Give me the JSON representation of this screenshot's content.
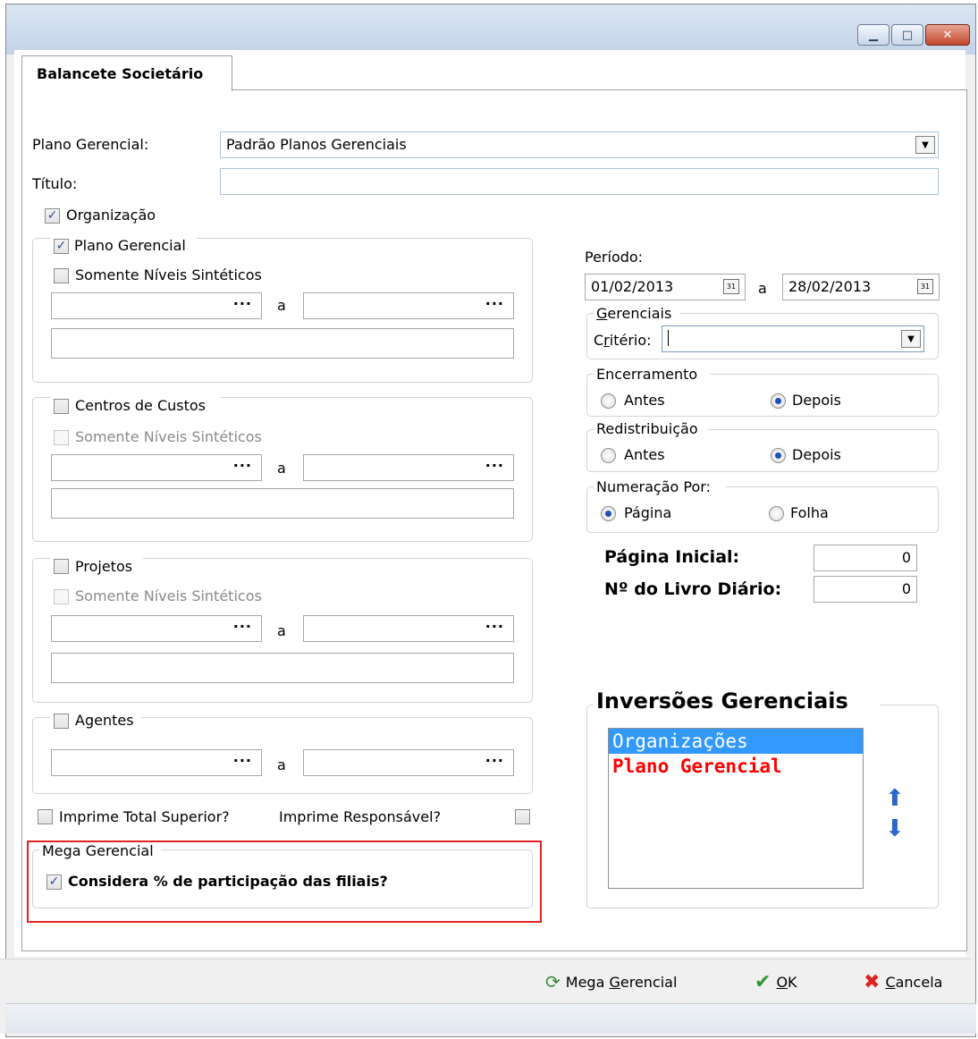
{
  "window": {
    "min_glyph": "▁",
    "max_glyph": "□",
    "close_glyph": "✕"
  },
  "tab": {
    "label": "Balancete Societário"
  },
  "plano_gerencial": {
    "label": "Plano Gerencial:",
    "value": "Padrão Planos Gerenciais"
  },
  "titulo": {
    "label": "Título:",
    "value": ""
  },
  "organizacao": {
    "label": "Organização",
    "checked": true
  },
  "grp_plano": {
    "label": "Plano Gerencial",
    "checked": true,
    "sintetico_label": "Somente Níveis Sintéticos",
    "dots": "···",
    "between": "a"
  },
  "grp_centros": {
    "label": "Centros de Custos",
    "sintetico_label": "Somente Níveis Sintéticos",
    "dots": "···",
    "between": "a"
  },
  "grp_projetos": {
    "label": "Projetos",
    "sintetico_label": "Somente Níveis Sintéticos",
    "dots": "···",
    "between": "a"
  },
  "grp_agentes": {
    "label": "Agentes",
    "dots": "···",
    "between": "a"
  },
  "imprime_total": {
    "label": "Imprime Total Superior?"
  },
  "imprime_resp": {
    "label": "Imprime Responsável?"
  },
  "mega_gerencial_group": {
    "label": "Mega Gerencial",
    "checkbox_label": "Considera % de participação das filiais?",
    "checked": true
  },
  "periodo": {
    "label": "Período:",
    "from": "01/02/2013",
    "between": "a",
    "to": "28/02/2013",
    "cal_glyph": "31"
  },
  "gerenciais": {
    "label_pre": "",
    "label_u": "G",
    "label_post": "erenciais",
    "criterio_u": "r",
    "criterio_pre": "C",
    "criterio_post": "itério:"
  },
  "encerramento": {
    "label": "Encerramento",
    "antes": "Antes",
    "depois": "Depois",
    "selected": "Depois"
  },
  "redistribuicao": {
    "label": "Redistribuição",
    "antes": "Antes",
    "depois": "Depois",
    "selected": "Depois"
  },
  "numeracao": {
    "label": "Numeração Por:",
    "pagina": "Página",
    "folha": "Folha",
    "selected": "Página"
  },
  "pagina_inicial": {
    "label": "Página Inicial:",
    "value": "0"
  },
  "livro_diario": {
    "label": "Nº do Livro Diário:",
    "value": "0"
  },
  "inversoes": {
    "title": "Inversões Gerenciais",
    "items": [
      "Organizações",
      "Plano Gerencial"
    ],
    "up_glyph": "⬆",
    "down_glyph": "⬇"
  },
  "footer": {
    "mega_pre": "Mega ",
    "mega_u": "G",
    "mega_post": "erencial",
    "ok_u": "O",
    "ok_post": "K",
    "cancel_u": "C",
    "cancel_post": "ancela",
    "ok_glyph": "✔",
    "cancel_glyph": "✖",
    "mega_icon_glyph": "⟳"
  },
  "colors": {
    "accent": "#3399ff",
    "highlight": "#e32222",
    "list_red": "#ff0000"
  }
}
